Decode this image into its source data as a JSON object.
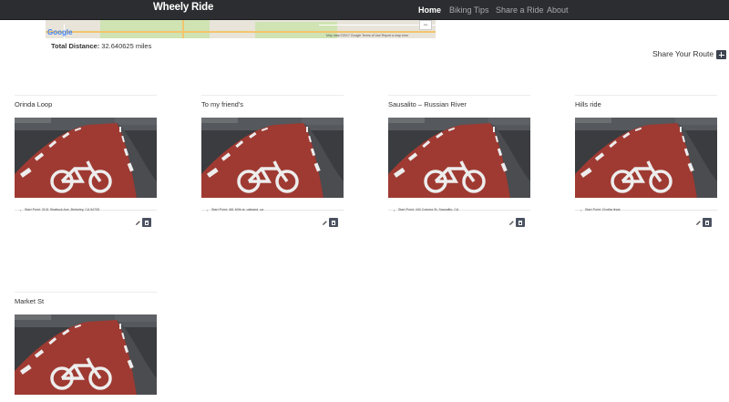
{
  "navbar": {
    "brand": "Wheely Ride",
    "items": [
      {
        "label": "Home",
        "active": true
      },
      {
        "label": "Biking Tips",
        "active": false
      },
      {
        "label": "Share a Ride",
        "active": false
      },
      {
        "label": "About",
        "active": false
      }
    ]
  },
  "map": {
    "logo": "Google",
    "zoom_label": "−",
    "footer": "Map data ©2017 Google   Terms of Use   Report a map error"
  },
  "route_summary": {
    "total_label": "Total Distance:",
    "total_value": "32.640625 miles"
  },
  "share": {
    "label": "Share Your Route",
    "icon": "plus-icon"
  },
  "rides": [
    {
      "title": "Orinda Loop",
      "start": "Start Point: 3101 Shattuck Ave, Berkeley, CA 94705"
    },
    {
      "title": "To my friend's",
      "start": "Start Point: 461 60th st. oakland. ca"
    },
    {
      "title": "Sausalito – Russian River",
      "start": "Start Point: 440 Coloma St, Sausalito, CA"
    },
    {
      "title": "Hills ride",
      "start": "Start Point: Cholita linda"
    },
    {
      "title": "Market St",
      "start": ""
    }
  ],
  "card_icons": {
    "edit": "pencil-icon",
    "delete": "trash-icon"
  },
  "colors": {
    "navbar_bg": "#2b2d30",
    "button_bg": "#4a5160",
    "bike_lane": "#9f3a32",
    "asphalt": "#3a3c3f"
  }
}
